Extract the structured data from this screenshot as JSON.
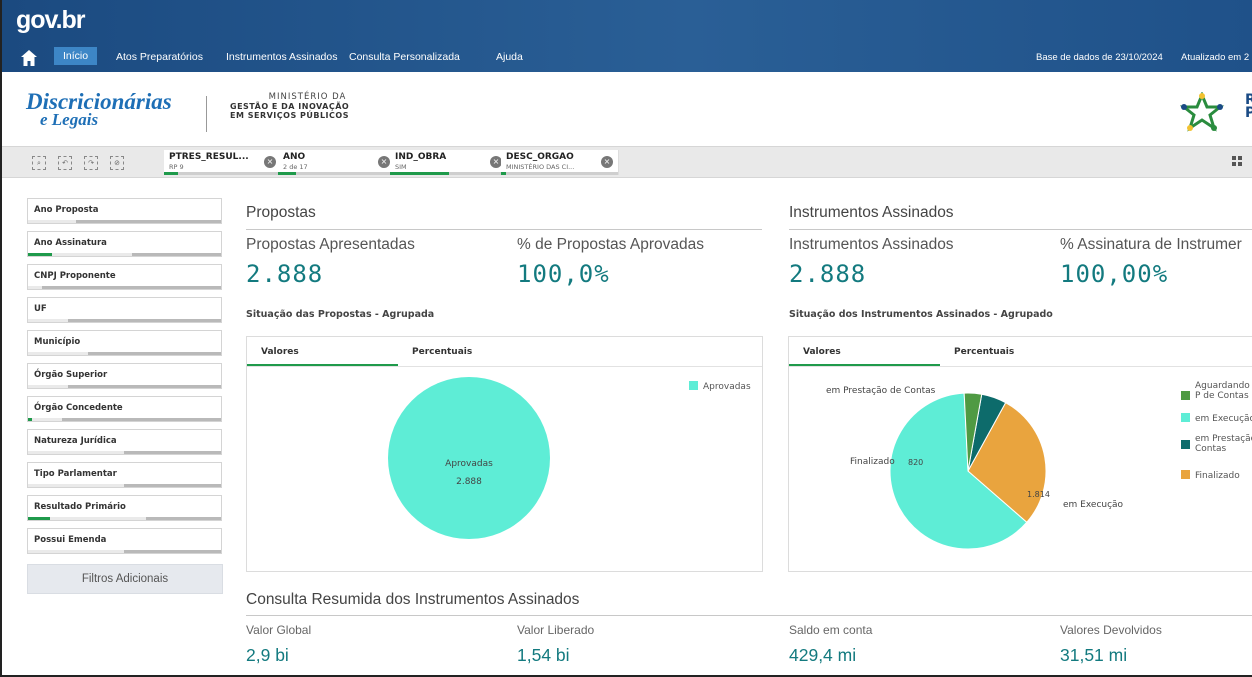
{
  "brand": {
    "gov_logo": "gov.br"
  },
  "nav": {
    "items": [
      "Início",
      "Atos Preparatórios",
      "Instrumentos Assinados",
      "Consulta Personalizada",
      "Ajuda"
    ],
    "db_date": "Base de dados de 23/10/2024",
    "updated": "Atualizado em 2"
  },
  "header": {
    "app_logo_line1": "Discricionárias",
    "app_logo_line2": "e Legais",
    "ministry_line1": "MINISTÉRIO DA",
    "ministry_line2": "GESTÃO E DA INOVAÇÃO",
    "ministry_line3": "EM SERVIÇOS PÚBLICOS",
    "partner_text": "R P"
  },
  "selections": [
    {
      "field": "PTRES_RESUL...",
      "value": "RP 9",
      "selected_fraction": 0.12
    },
    {
      "field": "ANO",
      "value": "2 de 17",
      "selected_fraction": 0.15
    },
    {
      "field": "IND_OBRA",
      "value": "SIM",
      "selected_fraction": 0.5
    },
    {
      "field": "DESC_ORGAO",
      "value": "MINISTÉRIO DAS CI...",
      "selected_fraction": 0.04
    }
  ],
  "filters": [
    "Ano Proposta",
    "Ano Assinatura",
    "CNPJ Proponente",
    "UF",
    "Município",
    "Órgão Superior",
    "Órgão Concedente",
    "Natureza Jurídica",
    "Tipo Parlamentar",
    "Resultado Primário",
    "Possui Emenda"
  ],
  "more_filters_label": "Filtros Adicionais",
  "propostas": {
    "title": "Propostas",
    "kpi1_label": "Propostas Apresentadas",
    "kpi1_value": "2.888",
    "kpi2_label": "% de Propostas Aprovadas",
    "kpi2_value": "100,0%",
    "chart_title": "Situação das Propostas - Agrupada",
    "tab1": "Valores",
    "tab2": "Percentuais",
    "legend": "Aprovadas",
    "slice_label": "Aprovadas",
    "slice_value": "2.888"
  },
  "instrumentos": {
    "title": "Instrumentos Assinados",
    "kpi1_label": "Instrumentos Assinados",
    "kpi1_value": "2.888",
    "kpi2_label": "% Assinatura de Instrumer",
    "kpi2_value": "100,00%",
    "chart_title": "Situação dos Instrumentos Assinados - Agrupado",
    "tab1": "Valores",
    "tab2": "Percentuais",
    "legend": [
      "Aguardando P de Contas",
      "em Execução",
      "em Prestação Contas",
      "Finalizado"
    ],
    "label_prestacao": "em Prestação de Contas",
    "label_finalizado": "Finalizado",
    "label_execucao": "em Execução",
    "value_finalizado": "820",
    "value_execucao": "1.814"
  },
  "consulta": {
    "title": "Consulta Resumida dos Instrumentos Assinados",
    "items": [
      {
        "label": "Valor Global",
        "value": "2,9 bi"
      },
      {
        "label": "Valor Liberado",
        "value": "1,54 bi"
      },
      {
        "label": "Saldo em conta",
        "value": "429,4 mi"
      },
      {
        "label": "Valores Devolvidos",
        "value": "31,51 mi"
      }
    ]
  },
  "colors": {
    "aprovadas": "#5eedd6",
    "aguardando": "#4f9a43",
    "execucao": "#5eedd6",
    "prestacao": "#0d6b6b",
    "finalizado": "#e9a43e",
    "accent": "#137a7f"
  },
  "chart_data": [
    {
      "type": "pie",
      "title": "Situação das Propostas - Agrupada",
      "categories": [
        "Aprovadas"
      ],
      "values": [
        2888
      ]
    },
    {
      "type": "pie",
      "title": "Situação dos Instrumentos Assinados - Agrupado",
      "categories": [
        "em Execução",
        "Finalizado",
        "em Prestação de Contas",
        "Aguardando Prestação de Contas"
      ],
      "values": [
        1814,
        820,
        150,
        104
      ]
    }
  ]
}
